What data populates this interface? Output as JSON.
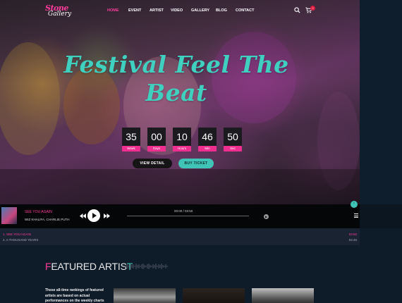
{
  "brand": {
    "logo_line1": "Stone",
    "logo_line2": "Gallery"
  },
  "nav": {
    "items": [
      {
        "label": "HOME",
        "active": true
      },
      {
        "label": "EVENT",
        "active": false
      },
      {
        "label": "ARTIST",
        "active": false
      },
      {
        "label": "VIDEO",
        "active": false
      },
      {
        "label": "GALLERY",
        "active": false
      },
      {
        "label": "BLOG",
        "active": false
      },
      {
        "label": "CONTACT",
        "active": false
      }
    ],
    "cart_count": "0",
    "icons": {
      "search": "search-icon",
      "cart": "cart-icon"
    }
  },
  "hero": {
    "title_line1": "Festival Feel The",
    "title_line2": "Beat",
    "countdown": [
      {
        "value": "35",
        "label": "Week"
      },
      {
        "value": "00",
        "label": "Days"
      },
      {
        "value": "10",
        "label": "Hours"
      },
      {
        "value": "46",
        "label": "Min"
      },
      {
        "value": "50",
        "label": "Sec"
      }
    ],
    "view_detail": "VIEW DETAIL",
    "buy_ticket": "BUY TICKET",
    "scroll_up_icon": "chevron-up-icon"
  },
  "player": {
    "title": "SEE YOU AGAIN",
    "artist": "WIZ KHALIFA, CHARLIE PUTH",
    "time": "00:00 / 03:50",
    "icons": {
      "prev": "previous-icon",
      "play": "play-icon",
      "next": "next-icon",
      "volume": "volume-icon",
      "menu": "menu-icon"
    }
  },
  "playlist": [
    {
      "label": "1. SEE YOU AGAIN",
      "duration": "03:50",
      "active": true
    },
    {
      "label": "2. A THOUSAND YEARS",
      "duration": "04:45",
      "active": false
    }
  ],
  "featured": {
    "title_first": "F",
    "title_mid": "EATURED ARTIS",
    "title_last": "T",
    "text": "These all-time rankings of featured artists are based on actual performances on the weekly charts"
  },
  "colors": {
    "accent": "#ff3c9d",
    "teal": "#3fc4b7",
    "bg": "#0e1b28"
  }
}
